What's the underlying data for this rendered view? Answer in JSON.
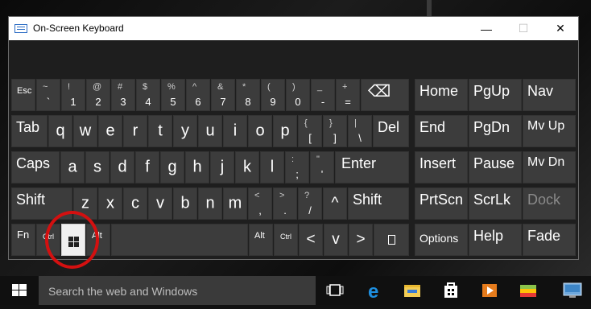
{
  "window": {
    "title": "On-Screen Keyboard"
  },
  "title_buttons": {
    "minimize": "—",
    "maximize": "☐",
    "close": "✕"
  },
  "keys": {
    "esc": "Esc",
    "tilde": {
      "top": "~",
      "bot": "`"
    },
    "n1": {
      "top": "!",
      "bot": "1"
    },
    "n2": {
      "top": "@",
      "bot": "2"
    },
    "n3": {
      "top": "#",
      "bot": "3"
    },
    "n4": {
      "top": "$",
      "bot": "4"
    },
    "n5": {
      "top": "%",
      "bot": "5"
    },
    "n6": {
      "top": "^",
      "bot": "6"
    },
    "n7": {
      "top": "&",
      "bot": "7"
    },
    "n8": {
      "top": "*",
      "bot": "8"
    },
    "n9": {
      "top": "(",
      "bot": "9"
    },
    "n0": {
      "top": ")",
      "bot": "0"
    },
    "minus": {
      "top": "_",
      "bot": "-"
    },
    "equals": {
      "top": "+",
      "bot": "="
    },
    "backspace": "⌫",
    "tab": "Tab",
    "q": "q",
    "w": "w",
    "e": "e",
    "r": "r",
    "t": "t",
    "y": "y",
    "u": "u",
    "i": "i",
    "o": "o",
    "p": "p",
    "lbracket": {
      "top": "{",
      "bot": "["
    },
    "rbracket": {
      "top": "}",
      "bot": "]"
    },
    "backslash": {
      "top": "|",
      "bot": "\\"
    },
    "del": "Del",
    "caps": "Caps",
    "a": "a",
    "s": "s",
    "d": "d",
    "f": "f",
    "g": "g",
    "h": "h",
    "j": "j",
    "k": "k",
    "l": "l",
    "semicolon": {
      "top": ":",
      "bot": ";"
    },
    "quote": {
      "top": "\"",
      "bot": "'"
    },
    "enter": "Enter",
    "shift_left": "Shift",
    "z": "z",
    "x": "x",
    "c": "c",
    "v": "v",
    "b": "b",
    "n": "n",
    "m": "m",
    "comma": {
      "top": "<",
      "bot": ","
    },
    "period": {
      "top": ">",
      "bot": "."
    },
    "slash": {
      "top": "?",
      "bot": "/"
    },
    "up": "^",
    "shift_right": "Shift",
    "fn": "Fn",
    "ctrl_left": "Ctrl",
    "alt_left": "Alt",
    "alt_right": "Alt",
    "ctrl_right": "Ctrl",
    "left": "<",
    "down": "v",
    "right": ">"
  },
  "nav_keys": {
    "home": "Home",
    "pgup": "PgUp",
    "nav": "Nav",
    "end": "End",
    "pgdn": "PgDn",
    "mvup": "Mv Up",
    "insert": "Insert",
    "pause": "Pause",
    "mvdn": "Mv Dn",
    "prtscn": "PrtScn",
    "scrlk": "ScrLk",
    "dock": "Dock",
    "options": "Options",
    "help": "Help",
    "fade": "Fade"
  },
  "taskbar": {
    "search_placeholder": "Search the web and Windows",
    "icons": [
      "windows-start-icon",
      "task-view-icon",
      "edge-icon",
      "file-explorer-icon",
      "store-icon",
      "media-player-icon",
      "bluestacks-icon",
      "network-icon"
    ]
  }
}
